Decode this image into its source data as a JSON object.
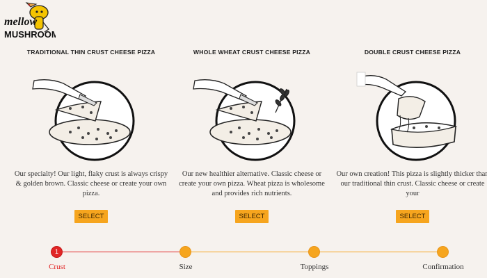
{
  "brand": {
    "logo_text_line1": "mellow",
    "logo_text_line2": "MUSHROOM"
  },
  "pizzas": [
    {
      "title": "TRADITIONAL THIN CRUST CHEESE PIZZA",
      "description": "Our specialty! Our light, flaky crust is always crispy & golden brown. Classic cheese or create your own pizza.",
      "button": "SELECT",
      "icon": "thin-crust-pizza-illustration"
    },
    {
      "title": "WHOLE WHEAT CRUST CHEESE PIZZA",
      "description": "Our new healthier alternative. Classic cheese or create your own pizza. Wheat pizza is wholesome and provides rich nutrients.",
      "button": "SELECT",
      "icon": "wheat-crust-pizza-illustration"
    },
    {
      "title": "DOUBLE CRUST CHEESE PIZZA",
      "description": "Our own creation! This pizza is slightly thicker than our traditional thin crust. Classic cheese or create your",
      "button": "SELECT",
      "icon": "double-crust-pizza-illustration"
    }
  ],
  "steps": [
    {
      "label": "Crust",
      "number": "1",
      "active": true
    },
    {
      "label": "Size",
      "number": "",
      "active": false
    },
    {
      "label": "Toppings",
      "number": "",
      "active": false
    },
    {
      "label": "Confirmation",
      "number": "",
      "active": false
    }
  ],
  "colors": {
    "accent": "#f6a51e",
    "active": "#e12626",
    "background": "#f6f2ee"
  }
}
